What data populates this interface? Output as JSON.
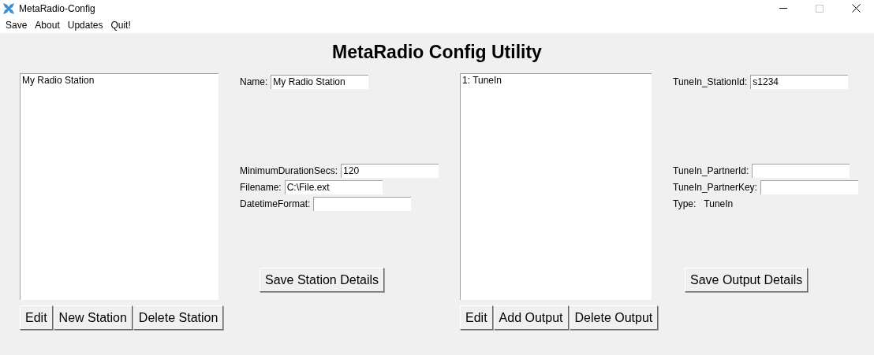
{
  "window": {
    "title": "MetaRadio-Config",
    "maximize_disabled": true
  },
  "menu": [
    "Save",
    "About",
    "Updates",
    "Quit!"
  ],
  "heading": "MetaRadio Config Utility",
  "stations": {
    "items": [
      "My Radio Station"
    ],
    "buttons": [
      "Edit",
      "New Station",
      "Delete Station"
    ]
  },
  "station_details": {
    "top_fields": [
      {
        "label": "Name:",
        "value": "My Radio Station"
      }
    ],
    "fields": [
      {
        "label": "MinimumDurationSecs:",
        "value": "120"
      },
      {
        "label": "Filename:",
        "value": "C:\\File.ext"
      },
      {
        "label": "DatetimeFormat:"
      }
    ],
    "save_button": "Save Station Details"
  },
  "outputs": {
    "items": [
      "1: TuneIn"
    ],
    "buttons": [
      "Edit",
      "Add Output",
      "Delete Output"
    ]
  },
  "output_details": {
    "top_fields": [
      {
        "label": "TuneIn_StationId:",
        "value": "s1234"
      }
    ],
    "fields": [
      {
        "label": "TuneIn_PartnerId:"
      },
      {
        "label": "TuneIn_PartnerKey:"
      }
    ],
    "type": {
      "label": "Type:",
      "value": "TuneIn"
    },
    "save_button": "Save Output Details"
  }
}
